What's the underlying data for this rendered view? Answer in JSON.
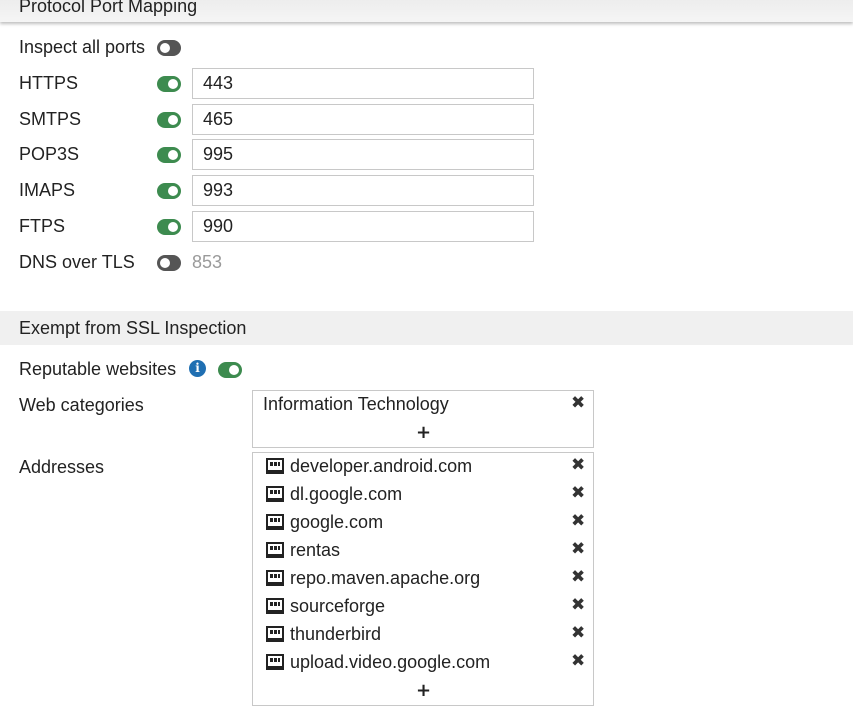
{
  "protocol_section": {
    "title": "Protocol Port Mapping",
    "inspect_all_ports": {
      "label": "Inspect all ports",
      "enabled": false
    },
    "ports": [
      {
        "label": "HTTPS",
        "enabled": true,
        "value": "443"
      },
      {
        "label": "SMTPS",
        "enabled": true,
        "value": "465"
      },
      {
        "label": "POP3S",
        "enabled": true,
        "value": "995"
      },
      {
        "label": "IMAPS",
        "enabled": true,
        "value": "993"
      },
      {
        "label": "FTPS",
        "enabled": true,
        "value": "990"
      },
      {
        "label": "DNS over TLS",
        "enabled": false,
        "value": "853"
      }
    ]
  },
  "exempt_section": {
    "title": "Exempt from SSL Inspection",
    "reputable_websites": {
      "label": "Reputable websites",
      "enabled": true,
      "info_icon": "info-icon"
    },
    "web_categories": {
      "label": "Web categories",
      "items": [
        "Information Technology"
      ],
      "add_icon": "+",
      "remove_icon": "✖"
    },
    "addresses": {
      "label": "Addresses",
      "item_icon": "address-object-icon",
      "items": [
        "developer.android.com",
        "dl.google.com",
        "google.com",
        "rentas",
        "repo.maven.apache.org",
        "sourceforge",
        "thunderbird",
        "upload.video.google.com"
      ],
      "add_icon": "+",
      "remove_icon": "✖"
    }
  },
  "colors": {
    "toggle_on": "#3d8b4f",
    "toggle_off": "#555555",
    "info": "#1f6fb2"
  }
}
